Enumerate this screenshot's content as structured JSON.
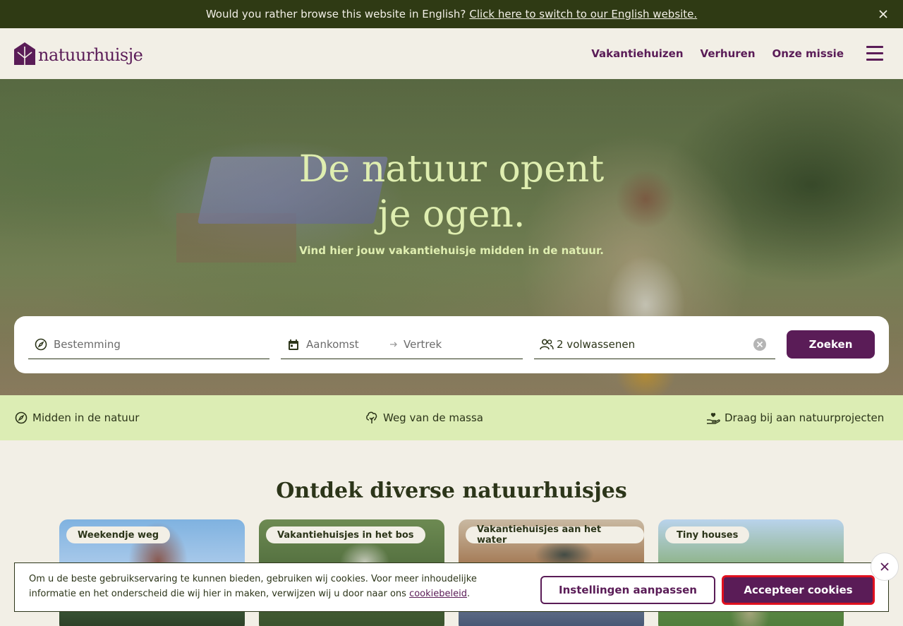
{
  "language_banner": {
    "message": "Would you rather browse this website in English?",
    "link": "Click here to switch to our English website.",
    "close_icon": "close-icon"
  },
  "header": {
    "logo_text": "natuurhuisje",
    "nav": [
      "Vakantiehuizen",
      "Verhuren",
      "Onze missie"
    ],
    "menu_icon": "hamburger-menu-icon"
  },
  "hero": {
    "title_line1": "De natuur opent",
    "title_line2": "je ogen.",
    "subtitle": "Vind hier jouw vakantiehuisje midden in de natuur."
  },
  "search": {
    "destination_placeholder": "Bestemming",
    "arrival_placeholder": "Aankomst",
    "departure_placeholder": "Vertrek",
    "guests_value": "2 volwassenen",
    "submit_label": "Zoeken"
  },
  "usps": [
    "Midden in de natuur",
    "Weg van de massa",
    "Draag bij aan natuurprojecten"
  ],
  "section": {
    "title": "Ontdek diverse natuurhuisjes",
    "cards": [
      "Weekendje weg",
      "Vakantiehuisjes in het bos",
      "Vakantiehuisjes aan het water",
      "Tiny houses"
    ]
  },
  "cookie": {
    "text_before_link": "Om u de beste gebruikservaring te kunnen bieden, gebruiken wij cookies. Voor meer inhoudelijke informatie en het onderscheid die wij hier in maken, verwijzen wij u door naar ons ",
    "link": "cookiebeleid",
    "text_after_link": ".",
    "settings_label": "Instellingen aanpassen",
    "accept_label": "Accepteer cookies"
  },
  "colors": {
    "brand_purple": "#5a1c57",
    "banner_green": "#2f3a14",
    "hero_text": "#dfeeb0",
    "usp_bar": "#dcedb4",
    "page_bg": "#f2efe6"
  }
}
